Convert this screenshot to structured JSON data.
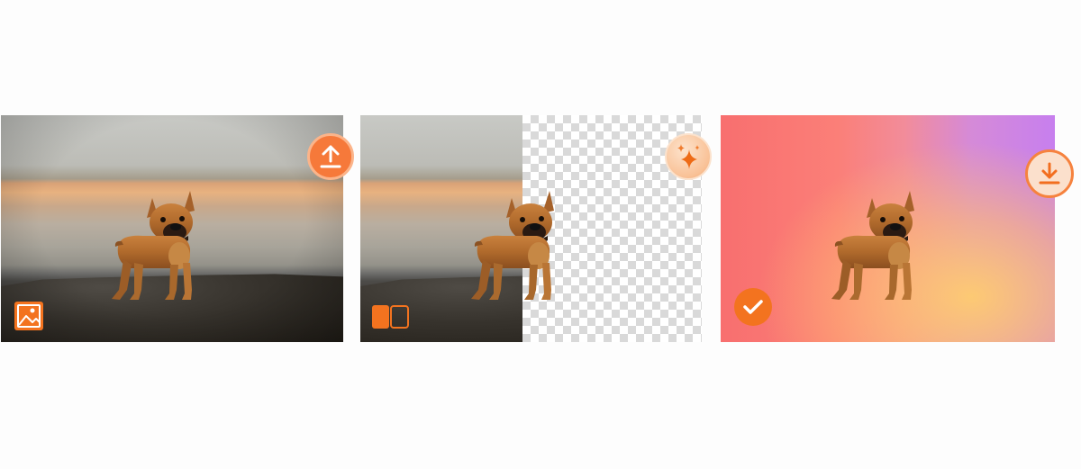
{
  "steps": [
    {
      "name": "upload",
      "icon": "upload-icon",
      "corner_icon": "image-icon"
    },
    {
      "name": "remove-background",
      "icon": "sparkle-icon",
      "corner_icon": "compare-icon"
    },
    {
      "name": "download",
      "icon": "download-icon",
      "corner_icon": "checkmark-icon"
    }
  ],
  "colors": {
    "accent": "#f6793a",
    "accent_light": "#fbe0cc",
    "gradient_start": "#f86f6f",
    "gradient_end": "#c77fee"
  }
}
